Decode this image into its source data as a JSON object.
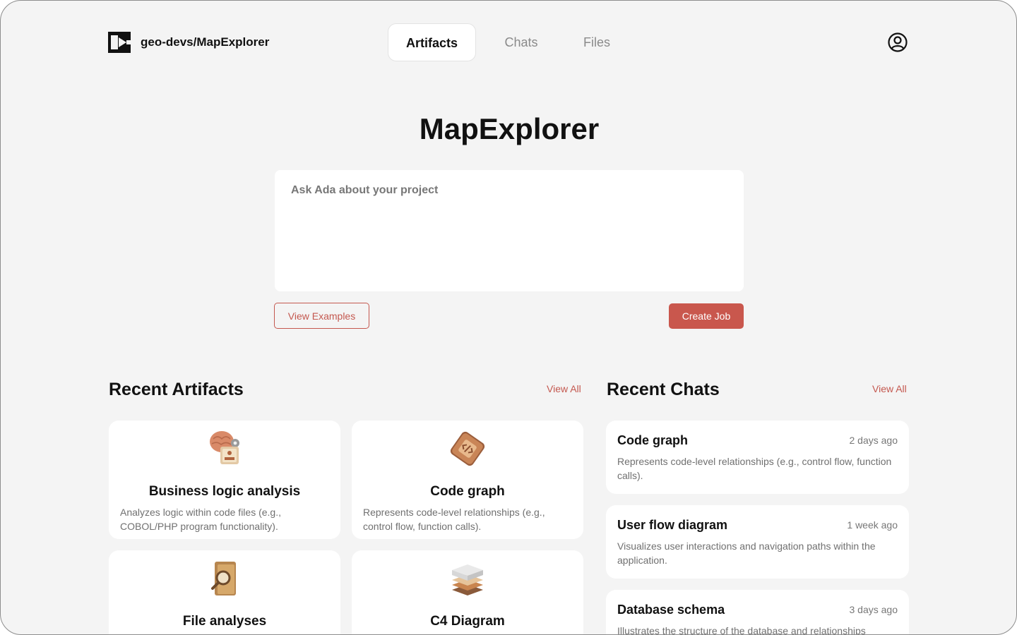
{
  "header": {
    "repo": "geo-devs/MapExplorer",
    "tabs": [
      "Artifacts",
      "Chats",
      "Files"
    ],
    "active_tab": "Artifacts",
    "logo_icon": "brand-logo-icon",
    "profile_icon": "user-circle-icon"
  },
  "main": {
    "title": "MapExplorer",
    "prompt_placeholder": "Ask Ada about your project",
    "view_examples": "View Examples",
    "create_job": "Create Job"
  },
  "artifacts": {
    "title": "Recent Artifacts",
    "view_all": "View All",
    "items": [
      {
        "title": "Business logic analysis",
        "desc": "Analyzes logic within code files (e.g., COBOL/PHP program functionality).",
        "icon": "brain-gear-icon"
      },
      {
        "title": "Code graph",
        "desc": "Represents code-level relationships (e.g., control flow, function calls).",
        "icon": "code-chip-icon"
      },
      {
        "title": "File analyses",
        "desc": "",
        "icon": "folder-magnifier-icon"
      },
      {
        "title": "C4 Diagram",
        "desc": "",
        "icon": "layers-stack-icon"
      }
    ]
  },
  "chats": {
    "title": "Recent Chats",
    "view_all": "View All",
    "items": [
      {
        "title": "Code graph",
        "time": "2 days ago",
        "desc": "Represents code-level relationships (e.g., control flow, function calls)."
      },
      {
        "title": "User flow diagram",
        "time": "1 week ago",
        "desc": "Visualizes user interactions and navigation paths within the application."
      },
      {
        "title": "Database schema",
        "time": "3 days ago",
        "desc": "Illustrates the structure of the database and relationships"
      }
    ]
  },
  "colors": {
    "accent": "#c9574d",
    "background": "#f4f4f4",
    "card": "#ffffff"
  }
}
